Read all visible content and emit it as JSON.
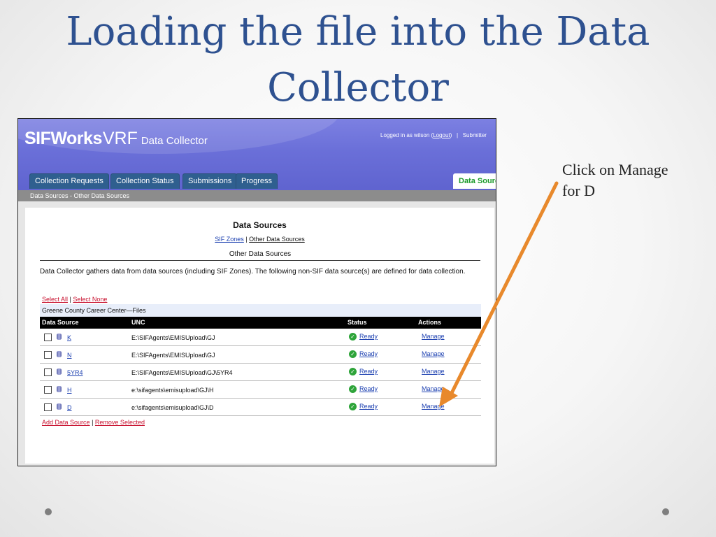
{
  "slide": {
    "title_line1": "Loading the file into the Data",
    "title_line2": "Collector",
    "callout_line1": "Click on Manage",
    "callout_line2": "for D"
  },
  "app": {
    "brand": "SIFWorks",
    "brand_suffix": "VRF",
    "app_name": "Data Collector",
    "user_prefix": "Logged in as wilson (",
    "logout": "Logout",
    "user_suffix": ")",
    "separator": "|",
    "submitter": "Submitter",
    "tabs": [
      "Collection Requests",
      "Collection Status",
      "Submissions",
      "Progress"
    ],
    "active_tab": "Data Sources",
    "breadcrumb": "Data Sources - Other Data Sources"
  },
  "page": {
    "title": "Data Sources",
    "link_sif": "SIF Zones",
    "link_sep": "|",
    "link_other": "Other Data Sources",
    "subtitle": "Other Data Sources",
    "description": "Data Collector gathers data from data sources (including SIF Zones). The following non-SIF data source(s) are defined for data collection.",
    "select_all": "Select All",
    "select_sep": "|",
    "select_none": "Select None",
    "group": "Greene County Career Center—Files",
    "columns": [
      "Data Source",
      "UNC",
      "Status",
      "Actions"
    ],
    "rows": [
      {
        "name": "K",
        "unc": "E:\\SIFAgents\\EMISUpload\\GJ",
        "status": "Ready",
        "action": "Manage"
      },
      {
        "name": "N",
        "unc": "E:\\SIFAgents\\EMISUpload\\GJ",
        "status": "Ready",
        "action": "Manage"
      },
      {
        "name": "5YR4",
        "unc": "E:\\SIFAgents\\EMISUpload\\GJ\\5YR4",
        "status": "Ready",
        "action": "Manage"
      },
      {
        "name": "H",
        "unc": "e:\\sifagents\\emisupload\\GJ\\H",
        "status": "Ready",
        "action": "Manage"
      },
      {
        "name": "D",
        "unc": "e:\\sifagents\\emisupload\\GJ\\D",
        "status": "Ready",
        "action": "Manage"
      }
    ],
    "add_source": "Add Data Source",
    "footer_sep": "|",
    "remove_selected": "Remove Selected"
  },
  "colors": {
    "title": "#2e5190",
    "header": "#6a6fd8",
    "tab": "#2f5f8f",
    "active_tab_text": "#1b9a2a",
    "arrow": "#e8892c"
  }
}
